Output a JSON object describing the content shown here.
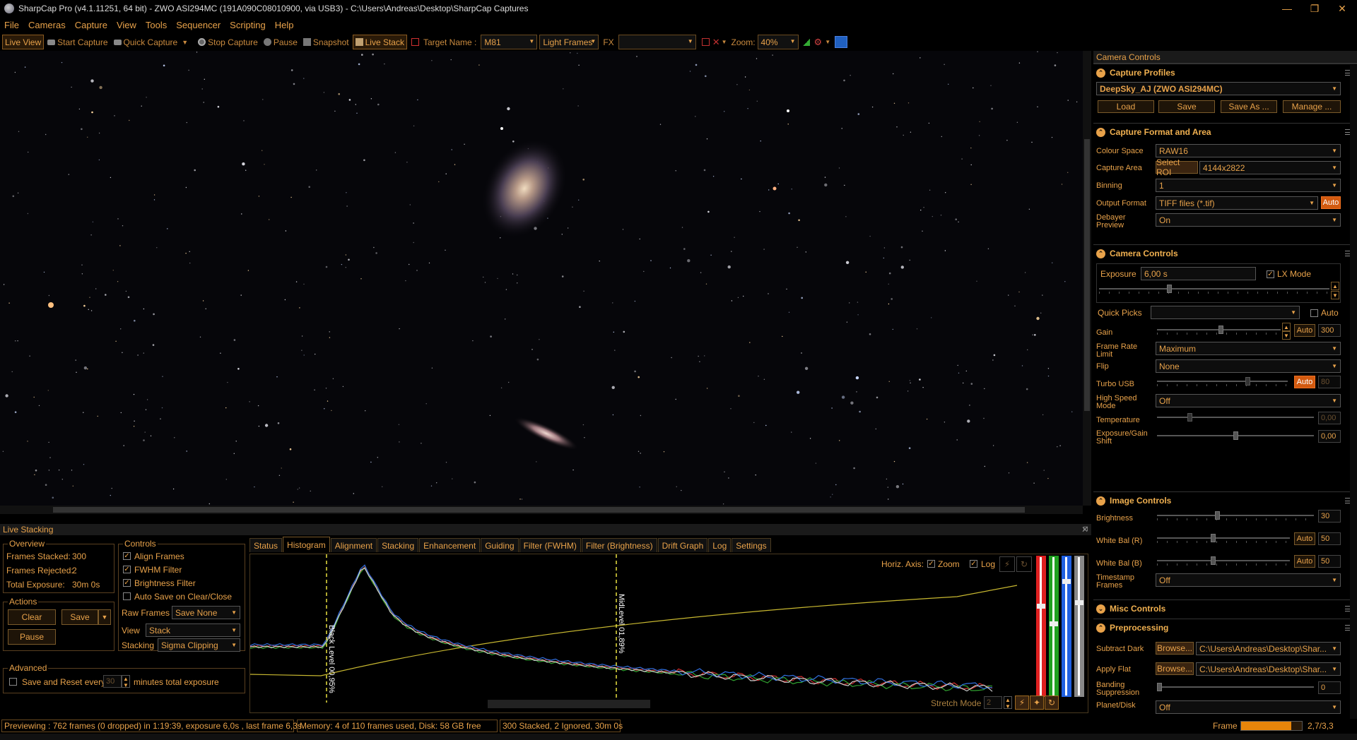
{
  "window": {
    "title": "SharpCap Pro (v4.1.11251, 64 bit) - ZWO ASI294MC (191A090C08010900, via USB3) - C:\\Users\\Andreas\\Desktop\\SharpCap Captures",
    "minimize": "—",
    "maximize": "❐",
    "close": "✕"
  },
  "menu": {
    "file": "File",
    "cameras": "Cameras",
    "capture": "Capture",
    "view": "View",
    "tools": "Tools",
    "sequencer": "Sequencer",
    "scripting": "Scripting",
    "help": "Help"
  },
  "toolbar": {
    "live_view": "Live View",
    "start_capture": "Start Capture",
    "quick_capture": "Quick Capture",
    "stop_capture": "Stop Capture",
    "pause": "Pause",
    "snapshot": "Snapshot",
    "live_stack": "Live Stack",
    "target_name_label": "Target Name :",
    "target_name_value": "M81",
    "frame_type": "Light Frames",
    "fx_label": "FX",
    "fx_value": "",
    "zoom_label": "Zoom:",
    "zoom_value": "40%"
  },
  "camera_controls": {
    "panel_title": "Camera Controls",
    "capture_profiles": {
      "title": "Capture Profiles",
      "selected": "DeepSky_AJ (ZWO ASI294MC)",
      "load": "Load",
      "save": "Save",
      "save_as": "Save As ...",
      "manage": "Manage ..."
    },
    "format_area": {
      "title": "Capture Format and Area",
      "colour_space_label": "Colour Space",
      "colour_space": "RAW16",
      "capture_area_label": "Capture Area",
      "select_roi": "Select ROI",
      "capture_area": "4144x2822",
      "binning_label": "Binning",
      "binning": "1",
      "output_format_label": "Output Format",
      "output_format": "TIFF files (*.tif)",
      "output_auto": "Auto",
      "debayer_label_1": "Debayer",
      "debayer_label_2": "Preview",
      "debayer": "On"
    },
    "controls": {
      "title": "Camera Controls",
      "exposure_label": "Exposure",
      "exposure": "6,00 s",
      "lx_mode": "LX Mode",
      "lx_mode_checked": true,
      "exposure_slider": 0.3,
      "quick_picks_label": "Quick Picks",
      "quick_picks": "",
      "quick_auto": "Auto",
      "gain_label": "Gain",
      "gain_auto": "Auto",
      "gain": "300",
      "gain_slider": 0.52,
      "frame_rate_label_1": "Frame Rate",
      "frame_rate_label_2": "Limit",
      "frame_rate": "Maximum",
      "flip_label": "Flip",
      "flip": "None",
      "turbo_label": "Turbo USB",
      "turbo_auto": "Auto",
      "turbo": "80",
      "turbo_slider": 0.7,
      "high_speed_label_1": "High Speed",
      "high_speed_label_2": "Mode",
      "high_speed": "Off",
      "temperature_label": "Temperature",
      "temperature": "0,00",
      "temperature_slider": 0.2,
      "exp_gain_label_1": "Exposure/Gain",
      "exp_gain_label_2": "Shift",
      "exp_gain": "0,00",
      "exp_gain_slider": 0.5
    },
    "image_controls": {
      "title": "Image Controls",
      "brightness_label": "Brightness",
      "brightness": "30",
      "brightness_slider": 0.38,
      "wb_r_label": "White Bal (R)",
      "wb_r_auto": "Auto",
      "wb_r": "50",
      "wb_r_slider": 0.42,
      "wb_b_label": "White Bal (B)",
      "wb_b_auto": "Auto",
      "wb_b": "50",
      "wb_b_slider": 0.42,
      "timestamp_label_1": "Timestamp",
      "timestamp_label_2": "Frames",
      "timestamp": "Off"
    },
    "misc_controls": {
      "title": "Misc Controls"
    },
    "preprocessing": {
      "title": "Preprocessing",
      "subtract_dark_label": "Subtract Dark",
      "browse": "Browse...",
      "subtract_dark": "C:\\Users\\Andreas\\Desktop\\Shar...",
      "apply_flat_label": "Apply Flat",
      "apply_flat": "C:\\Users\\Andreas\\Desktop\\Shar...",
      "banding_label_1": "Banding",
      "banding_label_2": "Suppression",
      "banding": "0",
      "planet_label": "Planet/Disk",
      "planet": "Off"
    }
  },
  "live_stacking": {
    "title": "Live Stacking",
    "overview": {
      "title": "Overview",
      "frames_stacked_label": "Frames Stacked:",
      "frames_stacked": "300",
      "frames_rejected_label": "Frames Rejected:",
      "frames_rejected": "2",
      "total_exposure_label": "Total Exposure:",
      "total_exposure": "30m 0s"
    },
    "actions": {
      "title": "Actions",
      "clear": "Clear",
      "save": "Save",
      "pause": "Pause"
    },
    "controls": {
      "title": "Controls",
      "align_frames": "Align Frames",
      "align_checked": true,
      "fwhm_filter": "FWHM Filter",
      "fwhm_checked": true,
      "brightness_filter": "Brightness Filter",
      "brightness_checked": true,
      "auto_save": "Auto Save on Clear/Close",
      "auto_save_checked": false,
      "raw_frames_label": "Raw Frames",
      "raw_frames": "Save None",
      "view_label": "View",
      "view": "Stack",
      "stacking_label": "Stacking",
      "stacking": "Sigma Clipping"
    },
    "advanced": {
      "title": "Advanced",
      "save_reset_label": "Save and Reset every",
      "save_reset_value": "30",
      "minutes_label": "minutes total exposure",
      "checked": false
    },
    "tabs": [
      "Status",
      "Histogram",
      "Alignment",
      "Stacking",
      "Enhancement",
      "Guiding",
      "Filter (FWHM)",
      "Filter (Brightness)",
      "Drift Graph",
      "Log",
      "Settings"
    ],
    "active_tab": "Histogram",
    "histogram": {
      "horiz_axis_label": "Horiz. Axis:",
      "zoom_label": "Zoom",
      "zoom_checked": true,
      "log_label": "Log",
      "log_checked": true,
      "black_level_label": "Black Level 00,95%",
      "mid_level_label": "MidLevel 01,89%",
      "stretch_mode_label": "Stretch Mode",
      "stretch_mode_value": "2"
    }
  },
  "status": {
    "previewing": "Previewing : 762 frames (0 dropped) in 1:19:39, exposure 6,0s , last frame 6,3s",
    "memory": "Memory: 4 of 110 frames used, Disk: 58 GB free",
    "stacked": "300 Stacked, 2 Ignored, 30m 0s",
    "frame_label": "Frame :",
    "frame_value": "2,7/3,3",
    "frame_progress": 0.82
  },
  "colors": {
    "accent": "#e8a24a",
    "active_orange": "#d25a10",
    "red_channel": "#e02020",
    "green_channel": "#20a020",
    "blue_channel": "#2060e0"
  }
}
